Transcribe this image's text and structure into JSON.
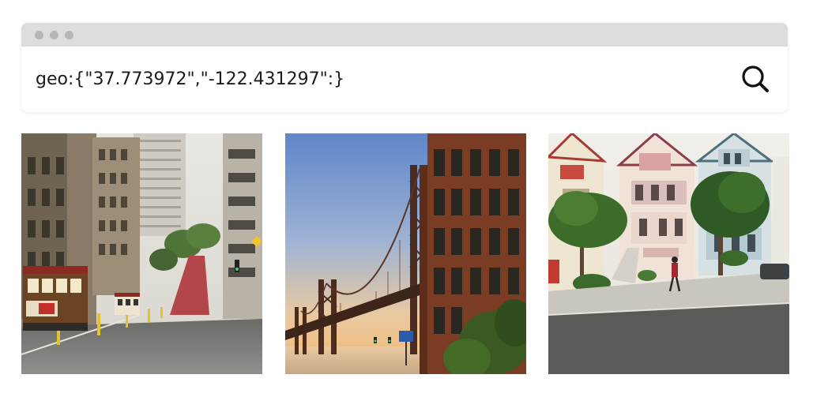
{
  "window": {
    "titlebar_dots": 3
  },
  "search": {
    "query": "geo:{\"37.773972\",\"-122.431297\":}",
    "button_icon": "search-icon"
  },
  "results": [
    {
      "subject": "cable-car-street-image"
    },
    {
      "subject": "bay-bridge-image"
    },
    {
      "subject": "painted-ladies-houses-image"
    }
  ],
  "colors": {
    "titlebar": "#dddddd",
    "dot": "#b6b6b6",
    "text": "#1b1b1b"
  }
}
